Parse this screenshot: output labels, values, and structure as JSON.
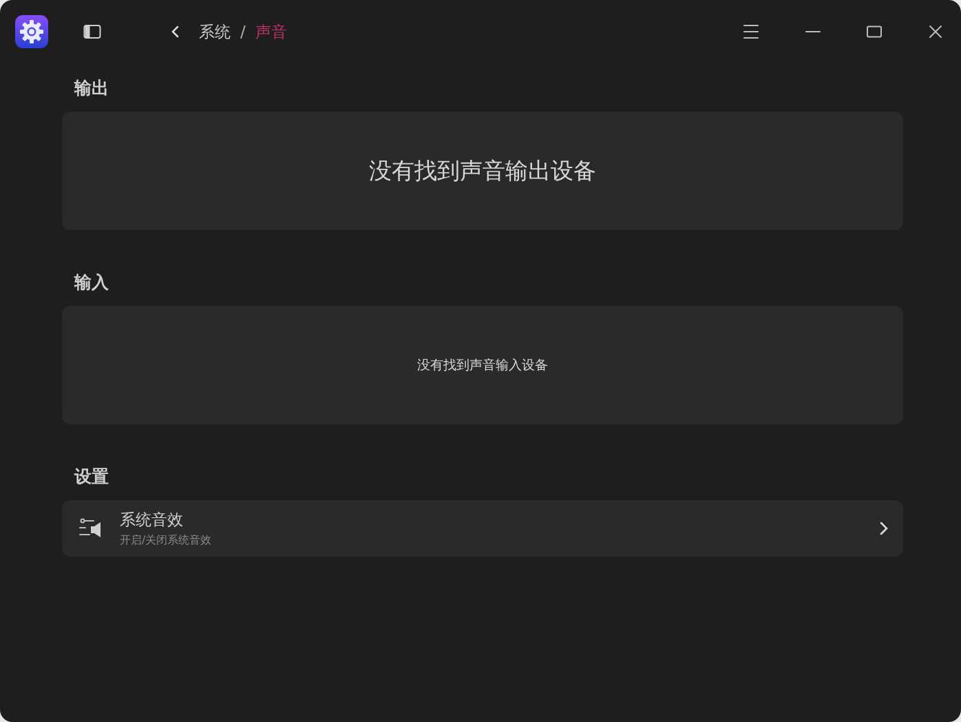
{
  "breadcrumb": [
    {
      "label": "系统",
      "selected": false
    },
    {
      "label": "声音",
      "selected": true
    }
  ],
  "breadcrumb_separator": "/",
  "sections": [
    {
      "title": "输出",
      "kind": "notice_large",
      "message": "没有找到声音输出设备"
    },
    {
      "title": "输入",
      "kind": "notice",
      "message": "没有找到声音输入设备"
    },
    {
      "title": "设置",
      "kind": "links",
      "items": [
        {
          "title": "系统音效",
          "subtitle": "开启/关闭系统音效"
        }
      ]
    }
  ]
}
